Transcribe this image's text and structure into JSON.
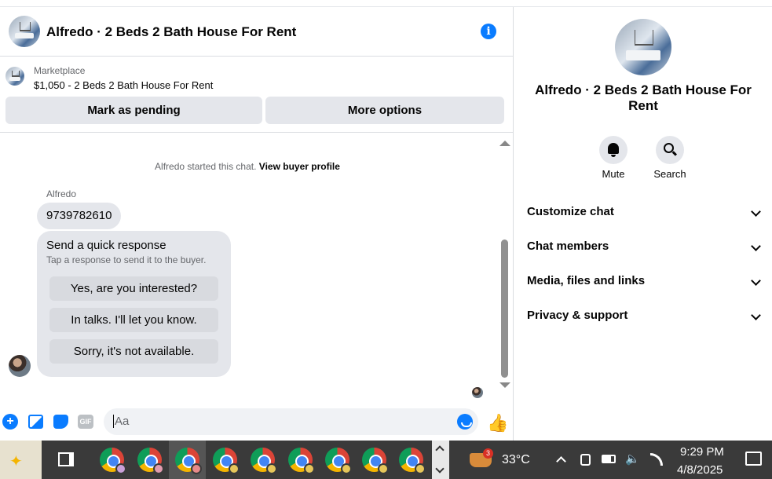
{
  "header": {
    "title": "Alfredo · 2 Beds 2 Bath House For Rent",
    "info_icon": "i"
  },
  "marketplace": {
    "label": "Marketplace",
    "price_line": "$1,050 - 2 Beds 2 Bath House For Rent",
    "mark_pending": "Mark as pending",
    "more_options": "More options"
  },
  "conversation": {
    "system_prefix": "Alfredo started this chat.",
    "system_link": "View buyer profile",
    "sender": "Alfredo",
    "message": "9739782610",
    "quick_title": "Send a quick response",
    "quick_sub": "Tap a response to send it to the buyer.",
    "quick_options": [
      "Yes, are you interested?",
      "In talks. I'll let you know.",
      "Sorry, it's not available."
    ]
  },
  "composer": {
    "placeholder": "Aa",
    "gif": "GIF",
    "plus": "+"
  },
  "sidebar": {
    "title": "Alfredo · 2 Beds 2 Bath House For Rent",
    "mute": "Mute",
    "search": "Search",
    "rows": [
      "Customize chat",
      "Chat members",
      "Media, files and links",
      "Privacy & support"
    ]
  },
  "taskbar": {
    "weather": "33°C",
    "weather_badge": "3",
    "time": "9:29 PM",
    "date": "4/8/2025"
  },
  "colors": {
    "accent": "#0a7cff",
    "bubble": "#e4e6eb",
    "taskbar": "#3a3a3a"
  }
}
